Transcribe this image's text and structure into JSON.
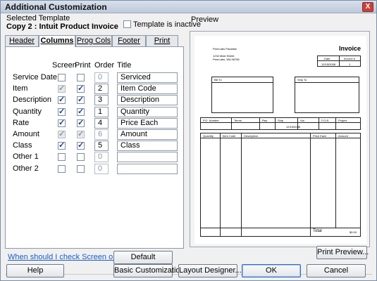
{
  "window": {
    "title": "Additional Customization",
    "close_glyph": "X"
  },
  "template": {
    "section_label": "Selected Template",
    "name": "Copy 2 : Intuit Product Invoice",
    "inactive_label": "Template is inactive",
    "inactive_checked": false
  },
  "tabs": [
    {
      "label": "Header",
      "active": false
    },
    {
      "label": "Columns",
      "active": true
    },
    {
      "label": "Prog Cols",
      "active": false
    },
    {
      "label": "Footer",
      "active": false
    },
    {
      "label": "Print",
      "active": false
    }
  ],
  "columns": {
    "headers": {
      "screen": "Screen",
      "print": "Print",
      "order": "Order",
      "title": "Title"
    },
    "rows": [
      {
        "field": "Service Date",
        "screen": false,
        "screen_disabled": false,
        "print": false,
        "print_disabled": false,
        "order": "0",
        "order_disabled": true,
        "title": "Serviced"
      },
      {
        "field": "Item",
        "screen": true,
        "screen_disabled": true,
        "print": true,
        "print_disabled": false,
        "order": "2",
        "order_disabled": false,
        "title": "Item Code"
      },
      {
        "field": "Description",
        "screen": true,
        "screen_disabled": false,
        "print": true,
        "print_disabled": false,
        "order": "3",
        "order_disabled": false,
        "title": "Description"
      },
      {
        "field": "Quantity",
        "screen": true,
        "screen_disabled": false,
        "print": true,
        "print_disabled": false,
        "order": "1",
        "order_disabled": false,
        "title": "Quantity"
      },
      {
        "field": "Rate",
        "screen": true,
        "screen_disabled": false,
        "print": true,
        "print_disabled": false,
        "order": "4",
        "order_disabled": false,
        "title": "Price Each"
      },
      {
        "field": "Amount",
        "screen": true,
        "screen_disabled": true,
        "print": true,
        "print_disabled": true,
        "order": "6",
        "order_disabled": true,
        "title": "Amount"
      },
      {
        "field": "Class",
        "screen": true,
        "screen_disabled": false,
        "print": true,
        "print_disabled": false,
        "order": "5",
        "order_disabled": false,
        "title": "Class"
      },
      {
        "field": "Other 1",
        "screen": false,
        "screen_disabled": false,
        "print": false,
        "print_disabled": false,
        "order": "0",
        "order_disabled": true,
        "title": ""
      },
      {
        "field": "Other 2",
        "screen": false,
        "screen_disabled": false,
        "print": false,
        "print_disabled": false,
        "order": "0",
        "order_disabled": true,
        "title": ""
      }
    ]
  },
  "help_link": "When should I check Screen or Print?",
  "default_button": "Default",
  "preview": {
    "label": "Preview",
    "doc_title": "Invoice",
    "company_lines": [
      "PeerLabs Paradise",
      "1234 Main Street",
      "PeerLabs, WA 98765"
    ],
    "date_header": "Date",
    "invoice_no_header": "Invoice #",
    "date_value": "12/15/2008",
    "invoice_no_value": "1",
    "bill_to": "Bill To",
    "ship_to": "Ship To",
    "info_headers": [
      "P.O. Number",
      "Terms",
      "Rep",
      "Ship",
      "Via",
      "F.O.B.",
      "Project"
    ],
    "ship_date": "12/15/2008",
    "line_headers": [
      "Quantity",
      "Item Code",
      "Description",
      "Price Each",
      "Amount"
    ],
    "total_label": "Total",
    "total_value": "$0.00",
    "print_preview_button": "Print Preview..."
  },
  "footer": {
    "help": "Help",
    "basic_customization": "Basic Customization...",
    "layout_designer": "Layout Designer...",
    "ok": "OK",
    "cancel": "Cancel"
  },
  "colors": {
    "link": "#1a5dc8",
    "title_bar": "#c6d2e2",
    "checkmark": "#1d3c8a"
  }
}
